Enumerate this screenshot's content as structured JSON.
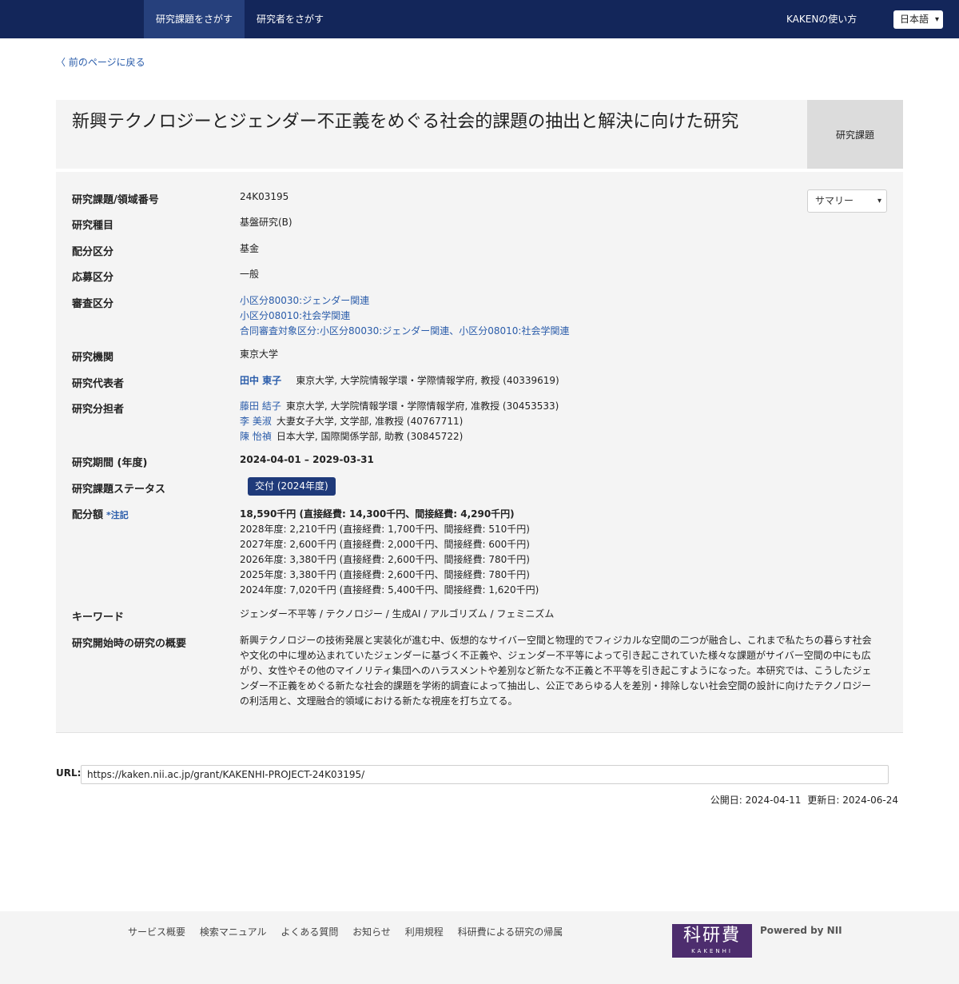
{
  "nav": {
    "tab_grants": "研究課題をさがす",
    "tab_researchers": "研究者をさがす",
    "howto": "KAKENの使い方",
    "lang": "日本語"
  },
  "back_link": "〈 前のページに戻る",
  "title": "新興テクノロジーとジェンダー不正義をめぐる社会的課題の抽出と解決に向けた研究",
  "title_badge": "研究課題",
  "view_select": "サマリー",
  "fields": {
    "number_label": "研究課題/領域番号",
    "number": "24K03195",
    "category_label": "研究種目",
    "category": "基盤研究(B)",
    "allocation_label": "配分区分",
    "allocation": "基金",
    "application_label": "応募区分",
    "application": "一般",
    "review_label": "審査区分",
    "review": [
      "小区分80030:ジェンダー関連",
      "小区分08010:社会学関連",
      "合同審査対象区分:小区分80030:ジェンダー関連、小区分08010:社会学関連"
    ],
    "institution_label": "研究機関",
    "institution": "東京大学",
    "pi_label": "研究代表者",
    "pi_name": "田中 東子",
    "pi_affil": "東京大学, 大学院情報学環・学際情報学府, 教授 (40339619)",
    "co_label": "研究分担者",
    "co": [
      {
        "name": "藤田 結子",
        "affil": "東京大学, 大学院情報学環・学際情報学府, 准教授 (30453533)"
      },
      {
        "name": "李 美淑",
        "affil": "大妻女子大学, 文学部, 准教授 (40767711)"
      },
      {
        "name": "陳 怡禎",
        "affil": "日本大学, 国際関係学部, 助教 (30845722)"
      }
    ],
    "period_label": "研究期間 (年度)",
    "period": "2024-04-01 – 2029-03-31",
    "status_label": "研究課題ステータス",
    "status": "交付 (2024年度)",
    "amount_label": "配分額",
    "amount_note": "*注記",
    "amount_total": "18,590千円 (直接経費: 14,300千円、間接経費: 4,290千円)",
    "amount_years": [
      "2028年度: 2,210千円 (直接経費: 1,700千円、間接経費: 510千円)",
      "2027年度: 2,600千円 (直接経費: 2,000千円、間接経費: 600千円)",
      "2026年度: 3,380千円 (直接経費: 2,600千円、間接経費: 780千円)",
      "2025年度: 3,380千円 (直接経費: 2,600千円、間接経費: 780千円)",
      "2024年度: 7,020千円 (直接経費: 5,400千円、間接経費: 1,620千円)"
    ],
    "keyword_label": "キーワード",
    "keywords": "ジェンダー不平等 / テクノロジー / 生成AI / アルゴリズム / フェミニズム",
    "abstract_label": "研究開始時の研究の概要",
    "abstract": "新興テクノロジーの技術発展と実装化が進む中、仮想的なサイバー空間と物理的でフィジカルな空間の二つが融合し、これまで私たちの暮らす社会や文化の中に埋め込まれていたジェンダーに基づく不正義や、ジェンダー不平等によって引き起こされていた様々な課題がサイバー空間の中にも広がり、女性やその他のマイノリティ集団へのハラスメントや差別など新たな不正義と不平等を引き起こすようになった。本研究では、こうしたジェンダー不正義をめぐる新たな社会的課題を学術的調査によって抽出し、公正であらゆる人を差別・排除しない社会空間の設計に向けたテクノロジーの利活用と、文理融合的領域における新たな視座を打ち立てる。"
  },
  "url_label": "URL:",
  "url": "https://kaken.nii.ac.jp/grant/KAKENHI-PROJECT-24K03195/",
  "published": "公開日: 2024-04-11",
  "updated": "更新日: 2024-06-24",
  "footer": {
    "links": [
      "サービス概要",
      "検索マニュアル",
      "よくある質問",
      "お知らせ",
      "利用規程",
      "科研費による研究の帰属"
    ],
    "logo_kanji": "科研費",
    "logo_roman": "KAKENHI",
    "powered": "Powered by NII"
  }
}
